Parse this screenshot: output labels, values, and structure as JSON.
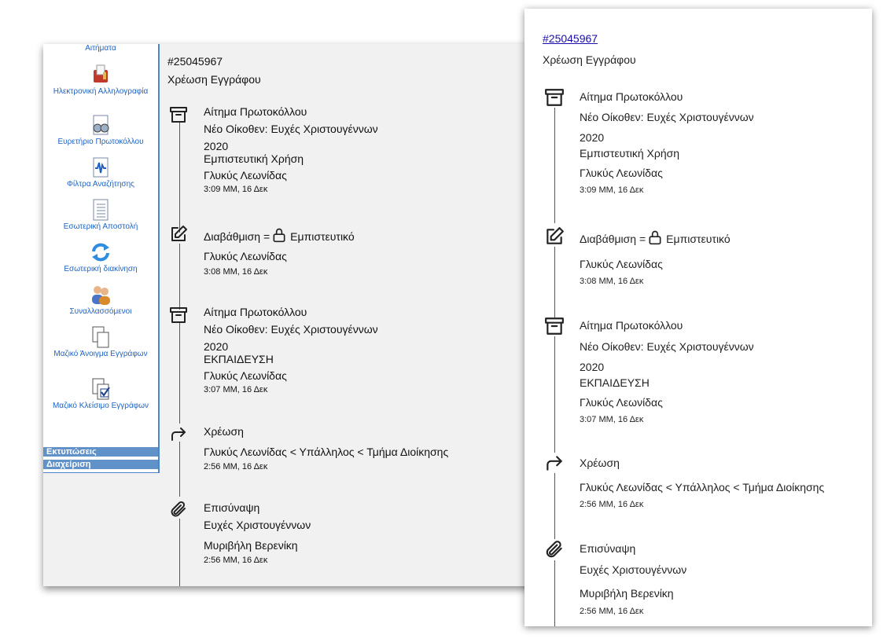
{
  "sidebar": {
    "items": [
      {
        "label": "Αιτήματα",
        "icon": "requests-icon"
      },
      {
        "label": "Ηλεκτρονική Αλληλογραφία",
        "icon": "mailbox-icon"
      },
      {
        "label": "Ευρετήριο Πρωτοκόλλου",
        "icon": "binoculars-icon"
      },
      {
        "label": "Φίλτρα Αναζήτησης",
        "icon": "waveform-document-icon"
      },
      {
        "label": "Εσωτερική Αποστολή",
        "icon": "list-document-icon"
      },
      {
        "label": "Εσωτερική διακίνηση",
        "icon": "refresh-arrows-icon"
      },
      {
        "label": "Συναλλασσόμενοι",
        "icon": "users-icon"
      },
      {
        "label": "Μαζικό Άνοιγμα Εγγράφων",
        "icon": "documents-icon"
      },
      {
        "label": "Μαζικό Κλείσιμο Εγγράφων",
        "icon": "documents-check-icon"
      }
    ],
    "sections": [
      {
        "label": "Εκτυπώσεις"
      },
      {
        "label": "Διαχείριση"
      }
    ]
  },
  "document": {
    "ref": "#25045967",
    "type": "Χρέωση Εγγράφου"
  },
  "timeline": [
    {
      "icon": "archive-icon",
      "title": "Αίτημα Πρωτοκόλλου",
      "lines": [
        "Νέο Οίκοθεν: Ευχές Χριστουγέννων",
        "2020",
        "Εμπιστευτική Χρήση",
        "Γλυκύς Λεωνίδας"
      ],
      "time": "3:09 ΜΜ, 16 Δεκ"
    },
    {
      "icon": "edit-icon",
      "title": "Διαβάθμιση =",
      "title_suffix": "Εμπιστευτικό",
      "lines": [
        "Γλυκύς Λεωνίδας"
      ],
      "time": "3:08 ΜΜ, 16 Δεκ"
    },
    {
      "icon": "archive-icon",
      "title": "Αίτημα Πρωτοκόλλου",
      "lines": [
        "Νέο Οίκοθεν: Ευχές Χριστουγέννων",
        "2020",
        "ΕΚΠΑΙΔΕΥΣΗ",
        "Γλυκύς Λεωνίδας"
      ],
      "time": "3:07 ΜΜ, 16 Δεκ"
    },
    {
      "icon": "forward-arrow-icon",
      "title": "Χρέωση",
      "lines": [
        "Γλυκύς Λεωνίδας < Υπάλληλος < Τμήμα Διοίκησης"
      ],
      "time": "2:56 ΜΜ, 16 Δεκ"
    },
    {
      "icon": "paperclip-icon",
      "title": "Επισύναψη",
      "lines": [
        "Ευχές Χριστουγέννων",
        "Μυριβήλη Βερενίκη"
      ],
      "time": "2:56 ΜΜ, 16 Δεκ"
    }
  ]
}
